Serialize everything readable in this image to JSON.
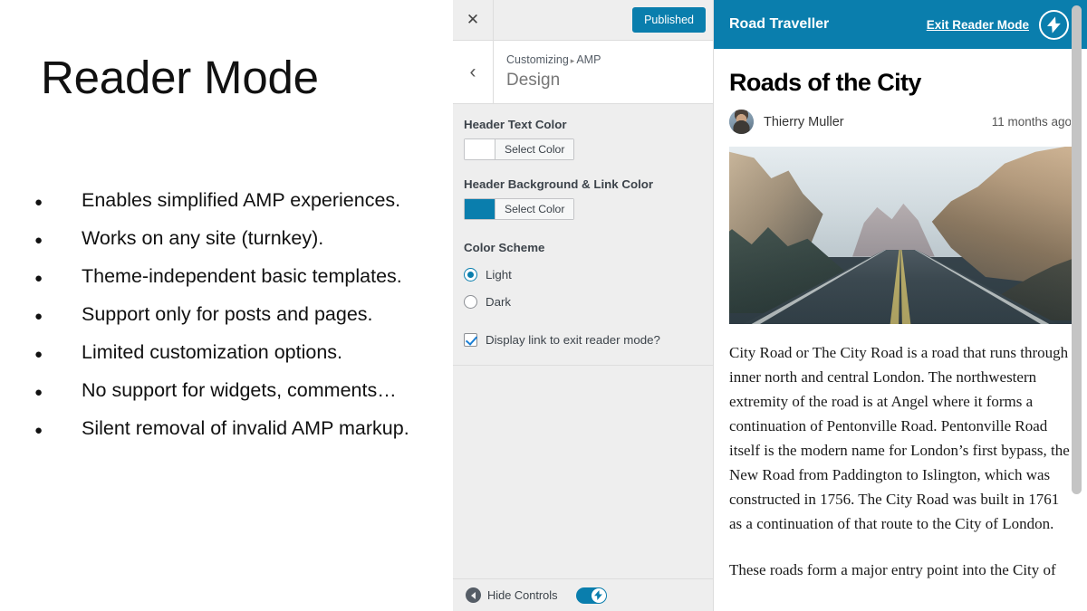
{
  "slide": {
    "title": "Reader Mode",
    "bullet_marker": "●",
    "bullets": [
      "Enables simplified AMP experiences.",
      "Works on any site (turnkey).",
      "Theme-independent basic templates.",
      "Support only for posts and pages.",
      "Limited customization options.",
      "No support for widgets, comments…",
      "Silent removal of invalid AMP markup."
    ]
  },
  "customizer": {
    "close_icon": "close-icon",
    "close_glyph": "✕",
    "publish_label": "Published",
    "back_glyph": "‹",
    "breadcrumb_root": "Customizing",
    "breadcrumb_sep": "▸",
    "breadcrumb_current": "AMP",
    "panel_title": "Design",
    "controls": {
      "header_text_color": {
        "label": "Header Text Color",
        "button_label": "Select Color",
        "value": "#ffffff"
      },
      "header_bg_link_color": {
        "label": "Header Background & Link Color",
        "button_label": "Select Color",
        "value": "#0a7ead"
      },
      "color_scheme": {
        "label": "Color Scheme",
        "options": [
          {
            "label": "Light",
            "selected": true
          },
          {
            "label": "Dark",
            "selected": false
          }
        ]
      },
      "exit_link_checkbox": {
        "label": "Display link to exit reader mode?",
        "checked": true
      }
    },
    "footer": {
      "hide_controls_label": "Hide Controls",
      "toggle_on": true,
      "toggle_icon": "amp-bolt-icon"
    }
  },
  "preview": {
    "header": {
      "site_title": "Road Traveller",
      "exit_link": "Exit Reader Mode",
      "badge_icon": "amp-bolt-icon",
      "background_color": "#0a7ead",
      "text_color": "#ffffff"
    },
    "article": {
      "title": "Roads of the City",
      "author": "Thierry Muller",
      "date": "11 months ago",
      "avatar_icon": "avatar",
      "featured_image_alt": "Desert highway running between rocky hills at dusk",
      "paragraphs": [
        "City Road or The City Road is a road that runs through inner north and central London. The northwestern extremity of the road is at Angel where it forms a continuation of Pentonville Road. Pentonville Road itself is the modern name for London’s first bypass, the New Road from Paddington to Islington, which was constructed in 1756. The City Road was built in 1761 as a continuation of that route to the City of London.",
        "These roads form a major entry point into the City of"
      ]
    }
  }
}
